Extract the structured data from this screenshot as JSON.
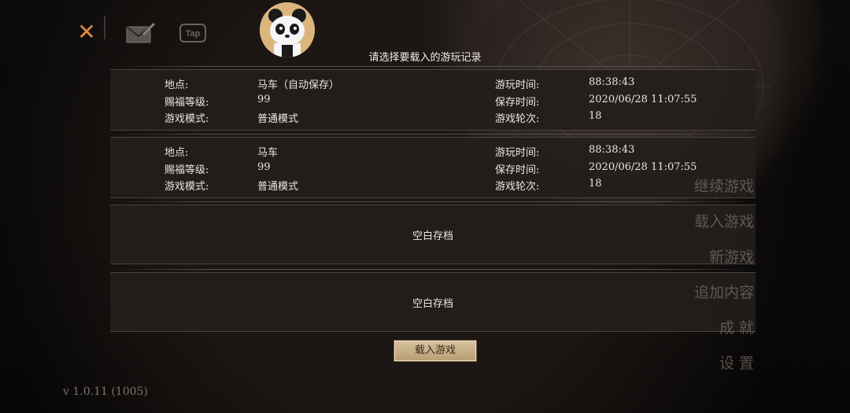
{
  "dialog": {
    "title": "请选择要载入的游玩记录"
  },
  "slots": [
    {
      "location_label": "地点:",
      "location": "马车（自动保存）",
      "level_label": "赐福等级:",
      "level": "99",
      "mode_label": "游戏模式:",
      "mode": "普通模式",
      "playtime_label": "游玩时间:",
      "playtime": "88:38:43",
      "savetime_label": "保存时间:",
      "savetime": "2020/06/28 11:07:55",
      "round_label": "游戏轮次:",
      "round": "18"
    },
    {
      "location_label": "地点:",
      "location": "马车",
      "level_label": "赐福等级:",
      "level": "99",
      "mode_label": "游戏模式:",
      "mode": "普通模式",
      "playtime_label": "游玩时间:",
      "playtime": "88:38:43",
      "savetime_label": "保存时间:",
      "savetime": "2020/06/28 11:07:55",
      "round_label": "游戏轮次:",
      "round": "18"
    },
    {
      "empty_label": "空白存档"
    },
    {
      "empty_label": "空白存档"
    }
  ],
  "buttons": {
    "load": "载入游戏"
  },
  "menu": [
    "继续游戏",
    "载入游戏",
    "新游戏",
    "追加内容",
    "成 就",
    "设 置"
  ],
  "version": "v 1.0.11 (1005)",
  "icons": {
    "close": "close-icon",
    "mail": "mail-icon",
    "tap": "tap-icon",
    "avatar": "panda-avatar"
  },
  "icon_text": {
    "tap": "Tap",
    "close": "✕"
  },
  "colors": {
    "accent": "#e08a45",
    "button": "#c9b38c",
    "panel": "#221e1c"
  }
}
